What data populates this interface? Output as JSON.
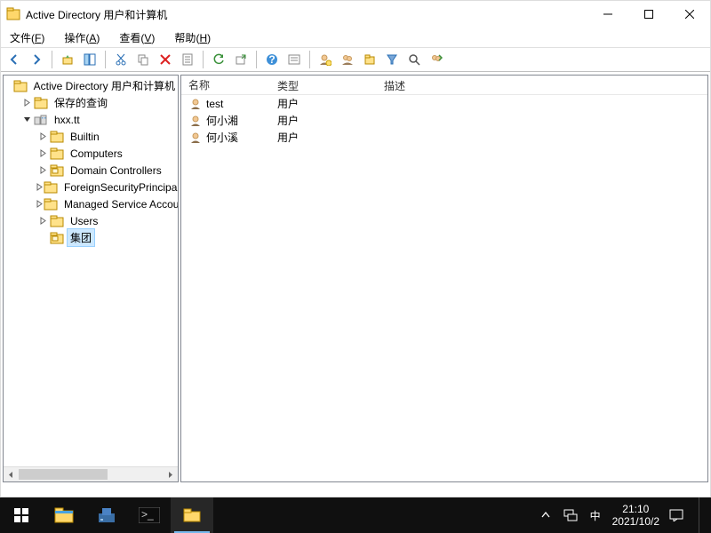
{
  "window": {
    "title": "Active Directory 用户和计算机"
  },
  "menu": {
    "file": {
      "label": "文件",
      "key": "F"
    },
    "action": {
      "label": "操作",
      "key": "A"
    },
    "view": {
      "label": "查看",
      "key": "V"
    },
    "help": {
      "label": "帮助",
      "key": "H"
    }
  },
  "tree": {
    "root": {
      "label": "Active Directory 用户和计算机"
    },
    "queries": {
      "label": "保存的查询"
    },
    "domain": {
      "label": "hxx.tt"
    },
    "children": [
      {
        "label": "Builtin"
      },
      {
        "label": "Computers"
      },
      {
        "label": "Domain Controllers"
      },
      {
        "label": "ForeignSecurityPrincipals"
      },
      {
        "label": "Managed Service Accounts"
      },
      {
        "label": "Users"
      },
      {
        "label": "集团"
      }
    ],
    "selected_index": 6
  },
  "list": {
    "columns": {
      "name": "名称",
      "type": "类型",
      "desc": "描述"
    },
    "rows": [
      {
        "name": "test",
        "type": "用户",
        "desc": ""
      },
      {
        "name": "何小湘",
        "type": "用户",
        "desc": ""
      },
      {
        "name": "何小溪",
        "type": "用户",
        "desc": ""
      }
    ]
  },
  "taskbar": {
    "time": "21:10",
    "date": "2021/10/2",
    "ime": "中"
  }
}
